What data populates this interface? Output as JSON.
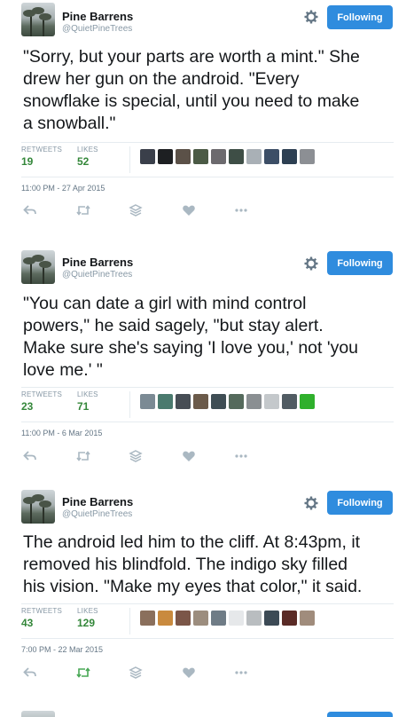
{
  "tweets": [
    {
      "name": "Pine Barrens",
      "handle": "@QuietPineTrees",
      "follow_label": "Following",
      "lines": [
        "\"Sorry, but your parts are worth a mint.\" She",
        "drew her gun on the android. \"Every",
        "snowflake is special, until you need to make",
        "a snowball.\""
      ],
      "retweets_label": "RETWEETS",
      "retweets": "19",
      "likes_label": "LIKES",
      "likes": "52",
      "timestamp": "11:00 PM - 27 Apr 2015"
    },
    {
      "name": "Pine Barrens",
      "handle": "@QuietPineTrees",
      "follow_label": "Following",
      "lines": [
        "\"You can date a girl with mind control",
        "powers,\" he said sagely, \"but stay alert.",
        "Make sure she's saying 'I love you,' not 'you",
        "love me.' \""
      ],
      "retweets_label": "RETWEETS",
      "retweets": "23",
      "likes_label": "LIKES",
      "likes": "71",
      "timestamp": "11:00 PM - 6 Mar 2015"
    },
    {
      "name": "Pine Barrens",
      "handle": "@QuietPineTrees",
      "follow_label": "Following",
      "lines": [
        "The android led him to the cliff. At 8:43pm, it",
        "removed his blindfold. The indigo sky filled",
        "his vision. \"Make my eyes that color,\" it said."
      ],
      "retweets_label": "RETWEETS",
      "retweets": "43",
      "likes_label": "LIKES",
      "likes": "129",
      "timestamp": "7:00 PM - 22 Mar 2015"
    }
  ],
  "icons": {
    "reply": "reply-icon",
    "retweet": "retweet-icon",
    "buffer": "layers-icon",
    "like": "heart-icon",
    "more": "more-icon",
    "settings": "gear-icon"
  },
  "colors": {
    "accent": "#2f8cde",
    "stat_value": "#34873a",
    "secondary_text": "#8899a6",
    "action_icon": "#aab8c2",
    "retweeted_green": "#48a855"
  }
}
